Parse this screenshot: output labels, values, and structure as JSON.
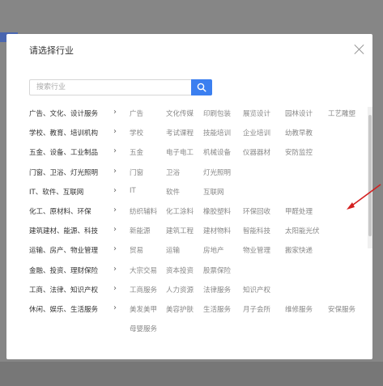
{
  "modal": {
    "title": "请选择行业",
    "search_placeholder": "搜索行业"
  },
  "industries": [
    {
      "label": "广告、文化、设计服务",
      "subs": [
        "广告",
        "文化传媒",
        "印刷包装",
        "展览设计",
        "园林设计",
        "工艺雕塑"
      ]
    },
    {
      "label": "学校、教育、培训机构",
      "subs": [
        "学校",
        "考试课程",
        "技能培训",
        "企业培训",
        "幼教早教"
      ]
    },
    {
      "label": "五金、设备、工业制品",
      "subs": [
        "五金",
        "电子电工",
        "机械设备",
        "仪器器材",
        "安防监控"
      ]
    },
    {
      "label": "门窗、卫浴、灯光照明",
      "subs": [
        "门窗",
        "卫浴",
        "灯光照明"
      ]
    },
    {
      "label": "IT、软件、互联网",
      "subs": [
        "IT",
        "软件",
        "互联网"
      ]
    },
    {
      "label": "化工、原材料、环保",
      "subs": [
        "纺织辅料",
        "化工涂料",
        "橡胶塑料",
        "环保回收",
        "甲醛处理"
      ]
    },
    {
      "label": "建筑建材、能源、科技",
      "subs": [
        "新能源",
        "建筑工程",
        "建材物料",
        "智能科技",
        "太阳能光伏"
      ]
    },
    {
      "label": "运输、房产、物业管理",
      "subs": [
        "贸易",
        "运输",
        "房地产",
        "物业管理",
        "搬家快递"
      ]
    },
    {
      "label": "金融、投资、理财保险",
      "subs": [
        "大宗交易",
        "资本投资",
        "股票保险"
      ]
    },
    {
      "label": "工商、法律、知识产权",
      "subs": [
        "工商服务",
        "人力资源",
        "法律服务",
        "知识产权"
      ]
    },
    {
      "label": "休闲、娱乐、生活服务",
      "subs": [
        "美发美甲",
        "美容护肤",
        "生活服务",
        "月子会所",
        "维修服务",
        "安保服务",
        "母婴服务"
      ]
    }
  ],
  "colors": {
    "accent": "#3b7ff0",
    "annotation": "#d42020"
  },
  "icons": {
    "close": "close-icon",
    "search": "search-icon",
    "arrow": "chevron-right-icon"
  }
}
